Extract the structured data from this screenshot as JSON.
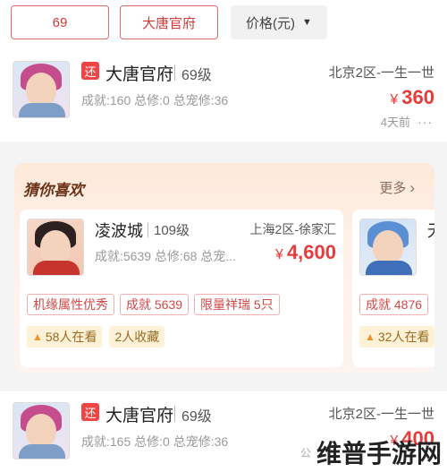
{
  "filters": {
    "level": "69",
    "school": "大唐官府",
    "price": "价格(元)"
  },
  "listings": [
    {
      "tag": "还",
      "school": "大唐官府",
      "level": "69级",
      "server": "北京2区-一生一世",
      "stats": "成就:160 总修:0 总宠修:36",
      "price_symbol": "¥",
      "price": "360",
      "time": "4天前",
      "more": "···"
    },
    {
      "tag": "还",
      "school": "大唐官府",
      "level": "69级",
      "server": "北京2区-一生一世",
      "stats": "成就:165 总修:0 总宠修:36",
      "price_symbol": "¥",
      "price": "400"
    }
  ],
  "recommend": {
    "title": "猜你喜欢",
    "more": "更多",
    "items": [
      {
        "school": "凌波城",
        "level": "109级",
        "server": "上海2区-徐家汇",
        "stats": "成就:5639 总修:68 总宠...",
        "price_symbol": "¥",
        "price": "4,600",
        "chips": [
          "机缘属性优秀",
          "成就 5639",
          "限量祥瑞 5只"
        ],
        "watching": "58人在看",
        "favorites": "2人收藏"
      },
      {
        "school": "无",
        "chips": [
          "成就 4876"
        ],
        "watching": "32人在看"
      }
    ]
  },
  "watermark": {
    "small": "公",
    "text": "维普手游网"
  },
  "colors": {
    "accent_red": "#e53b3b",
    "filter_border": "#e06b6b",
    "rec_bg": "#fde9d9"
  }
}
